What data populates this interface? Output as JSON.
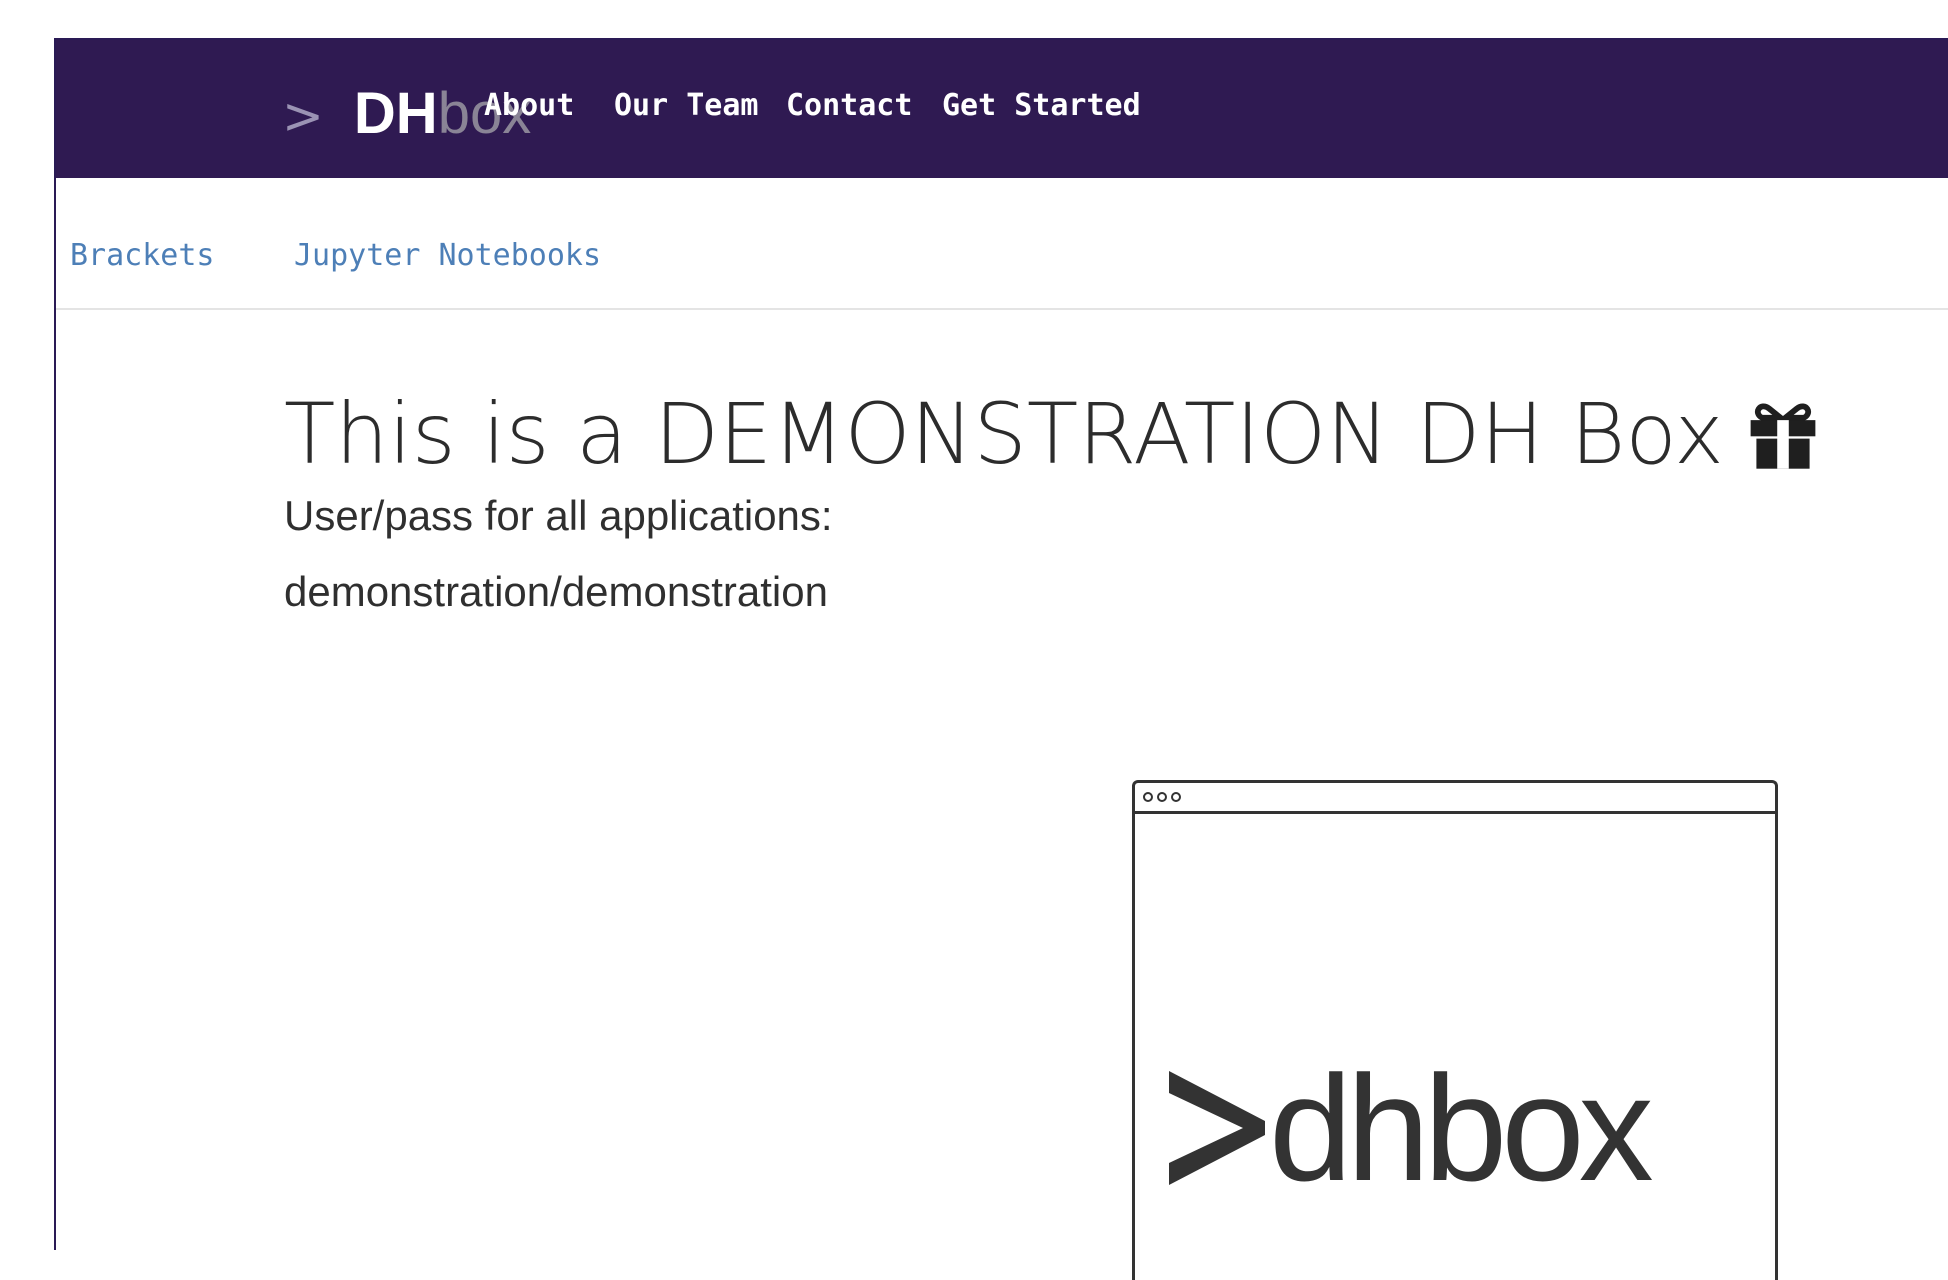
{
  "brand": {
    "caret": ">",
    "dh": "DH",
    "box": "box"
  },
  "nav": [
    {
      "label": "About"
    },
    {
      "label": "Our Team"
    },
    {
      "label": "Contact"
    },
    {
      "label": "Get Started"
    }
  ],
  "subnav": [
    {
      "label": "Brackets"
    },
    {
      "label": "Jupyter Notebooks"
    }
  ],
  "main": {
    "title": "This is a DEMONSTRATION DH Box",
    "title_icon": "gift-icon",
    "credentials_line1": "User/pass for all applications:",
    "credentials_line2": "demonstration/demonstration"
  },
  "illustration": {
    "logo_text": "dhbox",
    "logo_icon": "prompt-chevron-icon"
  },
  "colors": {
    "nav_bg": "#2f1a52",
    "link": "#4d7fb7",
    "text": "#2c2c2c"
  }
}
